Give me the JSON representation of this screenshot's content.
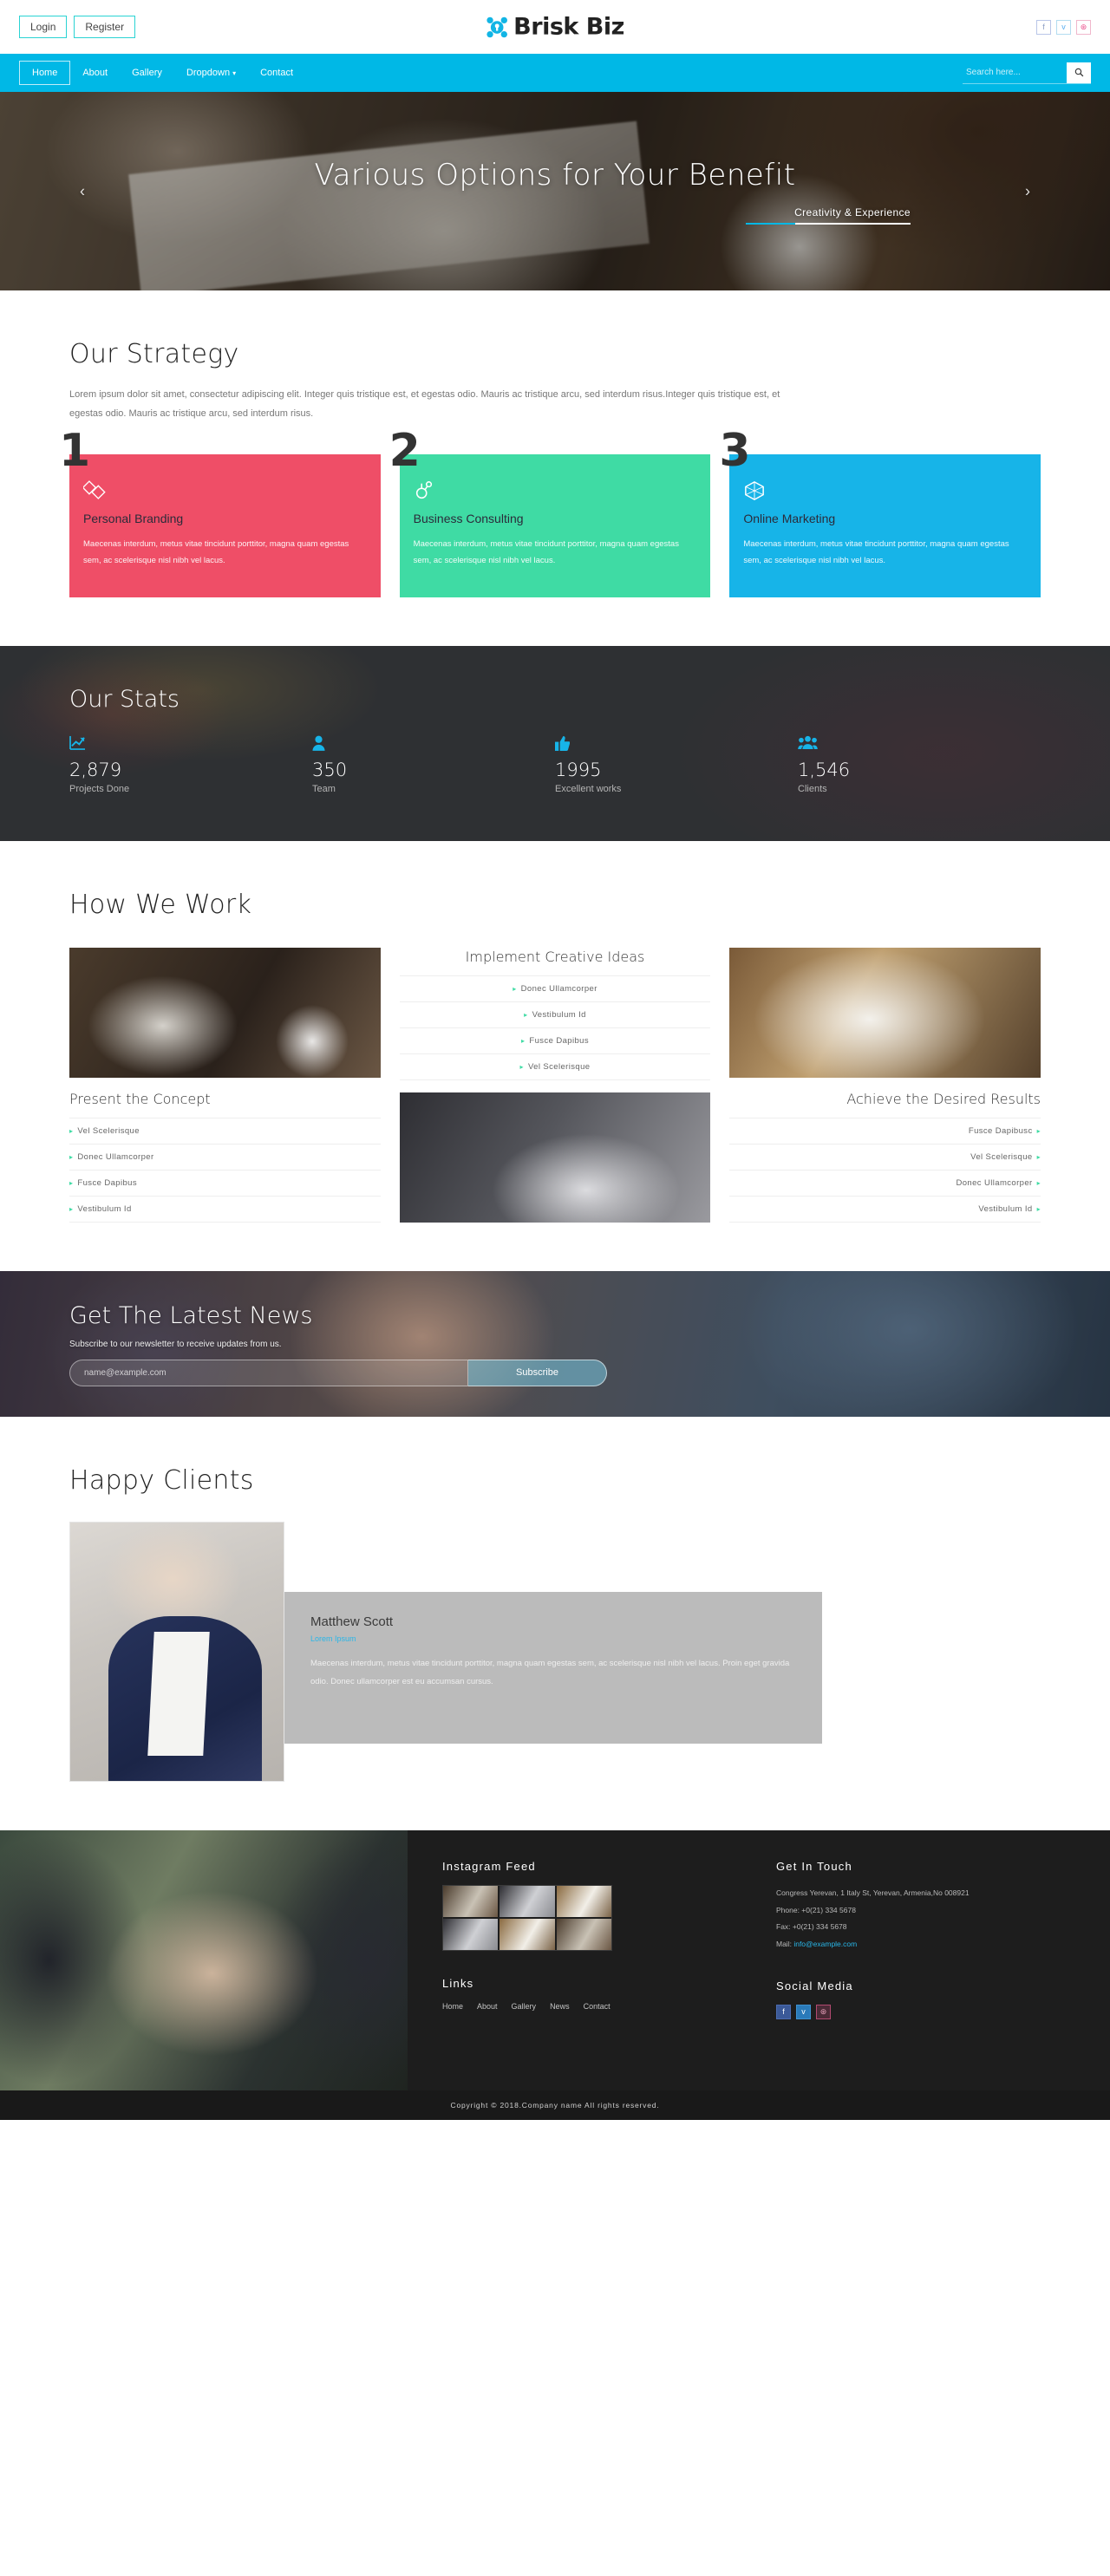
{
  "topbar": {
    "login_label": "Login",
    "register_label": "Register",
    "brand_name": "Brisk Biz",
    "social": [
      {
        "name": "facebook",
        "glyph": "f"
      },
      {
        "name": "twitter",
        "glyph": "ᴠ"
      },
      {
        "name": "dribbble",
        "glyph": "⊛"
      }
    ]
  },
  "nav": {
    "items": [
      {
        "label": "Home",
        "active": true
      },
      {
        "label": "About",
        "active": false
      },
      {
        "label": "Gallery",
        "active": false
      },
      {
        "label": "Dropdown",
        "active": false,
        "caret": true
      },
      {
        "label": "Contact",
        "active": false
      }
    ],
    "search_placeholder": "Search here...",
    "search_value": "",
    "search_icon": "⌕"
  },
  "hero": {
    "title": "Various Options for Your Benefit",
    "subtitle": "Creativity & Experience",
    "prev_arrow": "‹",
    "next_arrow": "›"
  },
  "strategy": {
    "title": "Our Strategy",
    "intro": "Lorem ipsum dolor sit amet, consectetur adipiscing elit. Integer quis tristique est, et egestas odio. Mauris ac tristique arcu, sed interdum risus.Integer quis tristique est, et egestas odio. Mauris ac tristique arcu, sed interdum risus.",
    "cards": [
      {
        "number": "1",
        "title": "Personal Branding",
        "desc": "Maecenas interdum, metus vitae tincidunt porttitor, magna quam egestas sem, ac scelerisque nisl nibh vel lacus.",
        "color": "#ef4e67",
        "icon": "link-squares-icon"
      },
      {
        "number": "2",
        "title": "Business Consulting",
        "desc": "Maecenas interdum, metus vitae tincidunt porttitor, magna quam egestas sem, ac scelerisque nisl nibh vel lacus.",
        "color": "#3fdba4",
        "icon": "hubspot-sprocket-icon"
      },
      {
        "number": "3",
        "title": "Online Marketing",
        "desc": "Maecenas interdum, metus vitae tincidunt porttitor, magna quam egestas sem, ac scelerisque nisl nibh vel lacus.",
        "color": "#17b4e8",
        "icon": "hexagon-network-icon"
      }
    ]
  },
  "stats": {
    "title": "Our Stats",
    "items": [
      {
        "value": "2,879",
        "label": "Projects Done",
        "icon": "chart-line-icon"
      },
      {
        "value": "350",
        "label": "Team",
        "icon": "user-icon"
      },
      {
        "value": "1995",
        "label": "Excellent works",
        "icon": "thumbs-up-icon"
      },
      {
        "value": "1,546",
        "label": "Clients",
        "icon": "users-group-icon"
      }
    ]
  },
  "how_we_work": {
    "title": "How We Work",
    "columns": [
      {
        "heading": "Present the Concept",
        "align": "left",
        "items": [
          "Vel Scelerisque",
          "Donec Ullamcorper",
          "Fusce Dapibus",
          "Vestibulum Id"
        ]
      },
      {
        "heading": "Implement Creative Ideas",
        "align": "center",
        "items": [
          "Donec Ullamcorper",
          "Vestibulum Id",
          "Fusce Dapibus",
          "Vel Scelerisque"
        ]
      },
      {
        "heading": "Achieve the Desired Results",
        "align": "right",
        "items": [
          "Fusce Dapibusc",
          "Vel Scelerisque",
          "Donec Ullamcorper",
          "Vestibulum Id"
        ]
      }
    ]
  },
  "newsletter": {
    "title": "Get The Latest News",
    "subtitle": "Subscribe to our newsletter to receive updates from us.",
    "email_placeholder": "name@example.com",
    "email_value": "",
    "button_label": "Subscribe"
  },
  "clients": {
    "title": "Happy Clients",
    "name": "Matthew Scott",
    "role": "Lorem Ipsum",
    "text": "Maecenas interdum, metus vitae tincidunt porttitor, magna quam egestas sem, ac scelerisque nisl nibh vel lacus. Proin eget gravida odio. Donec ullamcorper est eu accumsan cursus."
  },
  "footer": {
    "instagram_heading": "Instagram Feed",
    "links_heading": "Links",
    "links": [
      "Home",
      "About",
      "Gallery",
      "News",
      "Contact"
    ],
    "contact_heading": "Get In Touch",
    "address": "Congress Yerevan, 1 Italy St, Yerevan, Armenia,No 008921",
    "phone": "Phone: +0(21) 334 5678",
    "fax": "Fax: +0(21) 334 5678",
    "mail_label": "Mail:",
    "mail": "info@example.com",
    "social_heading": "Social Media",
    "social": [
      {
        "name": "facebook",
        "glyph": "f"
      },
      {
        "name": "twitter",
        "glyph": "ᴠ"
      },
      {
        "name": "dribbble",
        "glyph": "⊛"
      }
    ],
    "copyright": "Copyright © 2018.Company name All rights reserved."
  },
  "colors": {
    "accent_cyan": "#00b8e6",
    "card_pink": "#ef4e67",
    "card_green": "#3fdba4",
    "card_blue": "#17b4e8",
    "dark": "#2e3033"
  }
}
